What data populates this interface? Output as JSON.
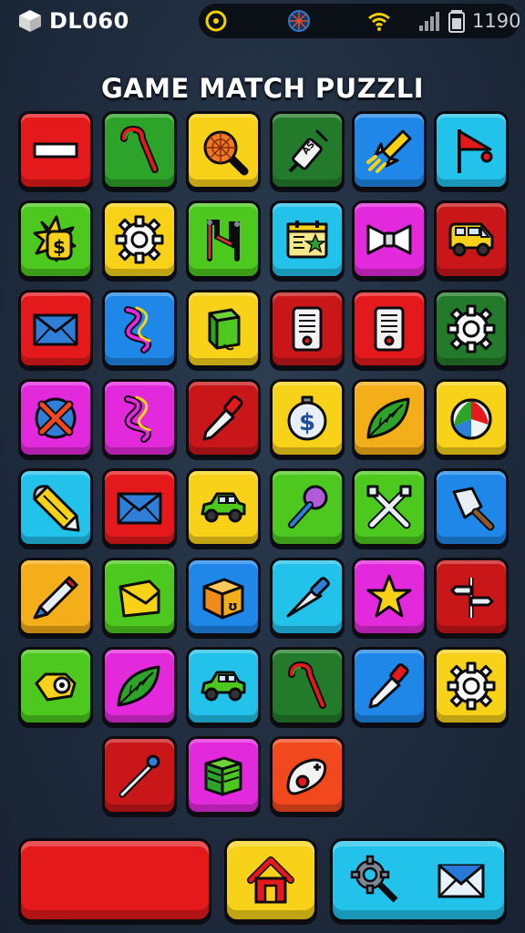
{
  "status_bar": {
    "title": "DL060",
    "clock": "1190",
    "icons": [
      "cube-icon",
      "circle-status-icon",
      "globe-icon",
      "wifi-icon",
      "signal-icon",
      "battery-icon"
    ]
  },
  "title": "GAME MATCH PUZZLI",
  "palette": {
    "red": "#e4191c",
    "green": "#2ea32a",
    "yellow": "#f7d219",
    "darkgreen": "#237a2b",
    "blue": "#1f87e8",
    "cyan": "#22c2ea",
    "lime": "#4cc81e",
    "magenta": "#e229dc",
    "crimson": "#c81619",
    "orange": "#f4ae19",
    "orangered": "#f2481e"
  },
  "board": {
    "rows": [
      [
        {
          "color": "red",
          "icon": "minus-bar-icon"
        },
        {
          "color": "green",
          "icon": "cane-icon"
        },
        {
          "color": "yellow",
          "icon": "magnifier-web-icon"
        },
        {
          "color": "darkgreen",
          "icon": "syringe-icon"
        },
        {
          "color": "blue",
          "icon": "rocket-icon"
        },
        {
          "color": "cyan",
          "icon": "flag-icon"
        }
      ],
      [
        {
          "color": "lime",
          "icon": "dollar-tag-icon"
        },
        {
          "color": "yellow",
          "icon": "gear-icon"
        },
        {
          "color": "lime",
          "icon": "clamp-icon"
        },
        {
          "color": "cyan",
          "icon": "calendar-icon"
        },
        {
          "color": "magenta",
          "icon": "bow-tie-icon"
        },
        {
          "color": "crimson",
          "icon": "van-icon"
        }
      ],
      [
        {
          "color": "red",
          "icon": "envelope-icon"
        },
        {
          "color": "blue",
          "icon": "ribbon-icon"
        },
        {
          "color": "yellow",
          "icon": "cube-icon"
        },
        {
          "color": "crimson",
          "icon": "device-icon"
        },
        {
          "color": "red",
          "icon": "device-icon"
        },
        {
          "color": "darkgreen",
          "icon": "gear-icon"
        }
      ],
      [
        {
          "color": "magenta",
          "icon": "cross-circle-icon"
        },
        {
          "color": "magenta",
          "icon": "ribbon-icon"
        },
        {
          "color": "crimson",
          "icon": "pen-icon"
        },
        {
          "color": "yellow",
          "icon": "dollar-clock-icon"
        },
        {
          "color": "orange",
          "icon": "leaf-icon"
        },
        {
          "color": "yellow",
          "icon": "beach-ball-icon"
        }
      ],
      [
        {
          "color": "cyan",
          "icon": "bullet-icon"
        },
        {
          "color": "red",
          "icon": "envelope-icon"
        },
        {
          "color": "yellow",
          "icon": "car-icon"
        },
        {
          "color": "lime",
          "icon": "microphone-icon"
        },
        {
          "color": "lime",
          "icon": "crossed-tools-icon"
        },
        {
          "color": "blue",
          "icon": "cleaver-icon"
        }
      ],
      [
        {
          "color": "orange",
          "icon": "pencil-icon"
        },
        {
          "color": "lime",
          "icon": "wallet-icon"
        },
        {
          "color": "blue",
          "icon": "box-icon"
        },
        {
          "color": "cyan",
          "icon": "blade-icon"
        },
        {
          "color": "magenta",
          "icon": "star-icon"
        },
        {
          "color": "crimson",
          "icon": "signpost-icon"
        }
      ],
      [
        {
          "color": "lime",
          "icon": "camera-icon"
        },
        {
          "color": "magenta",
          "icon": "leaf-icon"
        },
        {
          "color": "cyan",
          "icon": "car-icon"
        },
        {
          "color": "darkgreen",
          "icon": "cane-icon"
        },
        {
          "color": "blue",
          "icon": "pen-icon"
        },
        {
          "color": "yellow",
          "icon": "gear-icon"
        }
      ],
      [
        null,
        {
          "color": "crimson",
          "icon": "needle-icon"
        },
        {
          "color": "magenta",
          "icon": "book-cube-icon"
        },
        {
          "color": "orangered",
          "icon": "thermometer-icon"
        },
        null,
        null
      ]
    ]
  },
  "bottom_bar": {
    "left": {
      "color": "#e4191c"
    },
    "home": {
      "color": "#f7d219",
      "icon": "home-icon"
    },
    "right": {
      "color": "#22c2ea",
      "icons": [
        "settings-search-icon",
        "envelope-icon"
      ]
    }
  }
}
